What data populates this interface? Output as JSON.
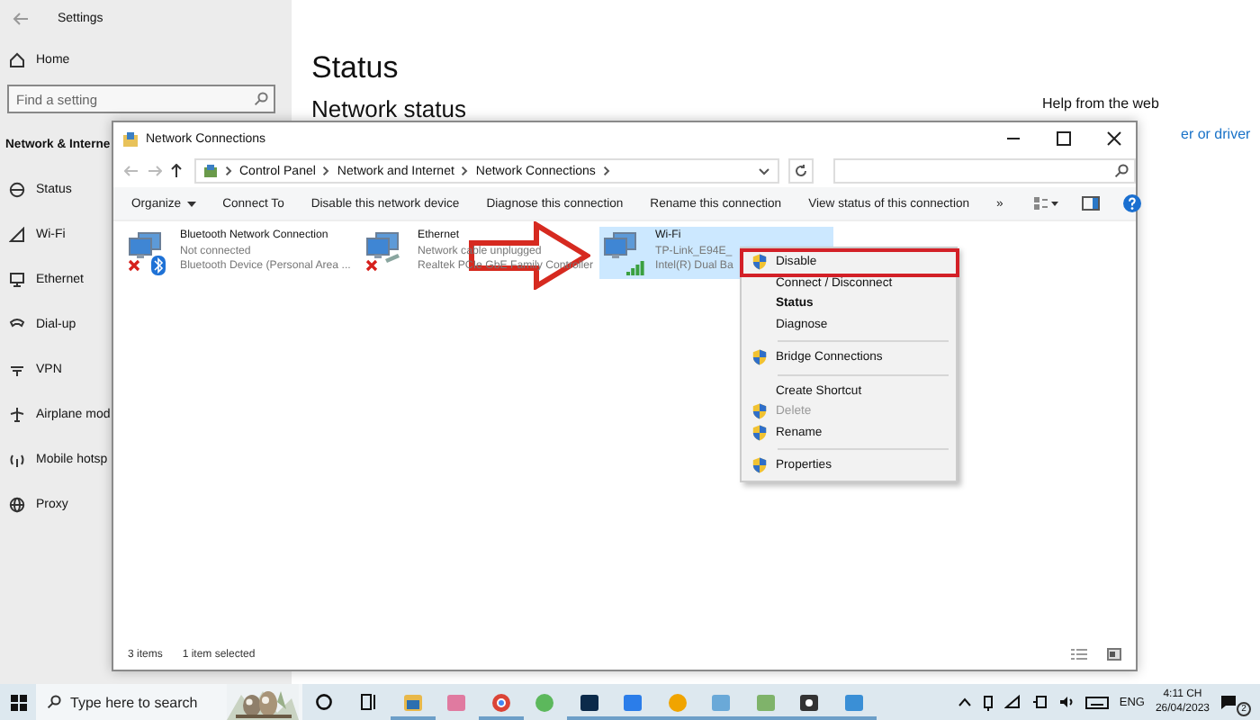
{
  "settings": {
    "title": "Settings",
    "home": "Home",
    "search": {
      "placeholder": "Find a setting"
    },
    "section": "Network & Interne",
    "nav": [
      {
        "label": "Status",
        "kind": "status"
      },
      {
        "label": "Wi-Fi",
        "kind": "wifi"
      },
      {
        "label": "Ethernet",
        "kind": "ethernet"
      },
      {
        "label": "Dial-up",
        "kind": "dialup"
      },
      {
        "label": "VPN",
        "kind": "vpn"
      },
      {
        "label": "Airplane mod",
        "kind": "airplane"
      },
      {
        "label": "Mobile hotsp",
        "kind": "hotspot"
      },
      {
        "label": "Proxy",
        "kind": "proxy"
      }
    ],
    "heading": "Status",
    "subheading": "Network status",
    "help_title": "Help from the web",
    "help_link": "er or driver"
  },
  "window": {
    "title": "Network Connections",
    "breadcrumb": [
      "Control Panel",
      "Network and Internet",
      "Network Connections"
    ]
  },
  "toolbar": [
    {
      "label": "Organize",
      "dropdown": true
    },
    {
      "label": "Connect To",
      "dropdown": false
    },
    {
      "label": "Disable this network device",
      "dropdown": false
    },
    {
      "label": "Diagnose this connection",
      "dropdown": false
    },
    {
      "label": "Rename this connection",
      "dropdown": false
    },
    {
      "label": "View status of this connection",
      "dropdown": false
    },
    {
      "label": "»",
      "dropdown": false
    }
  ],
  "connections": [
    {
      "name": "Bluetooth Network Connection",
      "status": "Not connected",
      "device": "Bluetooth Device (Personal Area ...",
      "kind": "bluetooth",
      "connected": false,
      "selected": false
    },
    {
      "name": "Ethernet",
      "status": "Network cable unplugged",
      "device": "Realtek PCIe GbE Family Controller",
      "kind": "ethernet",
      "connected": false,
      "selected": false
    },
    {
      "name": "Wi-Fi",
      "status": "TP-Link_E94E_",
      "device": "Intel(R) Dual Ba",
      "kind": "wifi",
      "connected": true,
      "selected": true
    }
  ],
  "context_menu": [
    {
      "kind": "item",
      "label": "Disable",
      "shield": true,
      "default": false,
      "disabled": false,
      "highlighted": true
    },
    {
      "kind": "item",
      "label": "Connect / Disconnect",
      "shield": false,
      "default": false,
      "disabled": false,
      "highlighted": false
    },
    {
      "kind": "item",
      "label": "Status",
      "shield": false,
      "default": true,
      "disabled": false,
      "highlighted": false
    },
    {
      "kind": "item",
      "label": "Diagnose",
      "shield": false,
      "default": false,
      "disabled": false,
      "highlighted": false
    },
    {
      "kind": "separator"
    },
    {
      "kind": "item",
      "label": "Bridge Connections",
      "shield": true,
      "default": false,
      "disabled": false,
      "highlighted": false
    },
    {
      "kind": "separator"
    },
    {
      "kind": "item",
      "label": "Create Shortcut",
      "shield": false,
      "default": false,
      "disabled": false,
      "highlighted": false
    },
    {
      "kind": "item",
      "label": "Delete",
      "shield": true,
      "default": false,
      "disabled": true,
      "highlighted": false
    },
    {
      "kind": "item",
      "label": "Rename",
      "shield": true,
      "default": false,
      "disabled": false,
      "highlighted": false
    },
    {
      "kind": "separator"
    },
    {
      "kind": "item",
      "label": "Properties",
      "shield": true,
      "default": false,
      "disabled": false,
      "highlighted": false
    }
  ],
  "status_bar": {
    "count": "3 items",
    "selection": "1 item selected"
  },
  "taskbar": {
    "search": {
      "placeholder": "Type here to search"
    },
    "apps": [
      {
        "kind": "explorer",
        "running": true
      },
      {
        "kind": "pink",
        "running": false
      },
      {
        "kind": "chrome",
        "running": true
      },
      {
        "kind": "green",
        "running": false
      },
      {
        "kind": "photoshop",
        "running": true
      },
      {
        "kind": "zalo",
        "running": true
      },
      {
        "kind": "orange",
        "running": true
      },
      {
        "kind": "drive",
        "running": true
      },
      {
        "kind": "chart",
        "running": true
      },
      {
        "kind": "gear",
        "running": true
      },
      {
        "kind": "window",
        "running": true
      }
    ],
    "language": "ENG",
    "time": "4:11 CH",
    "date": "26/04/2023",
    "notifications": "2"
  }
}
